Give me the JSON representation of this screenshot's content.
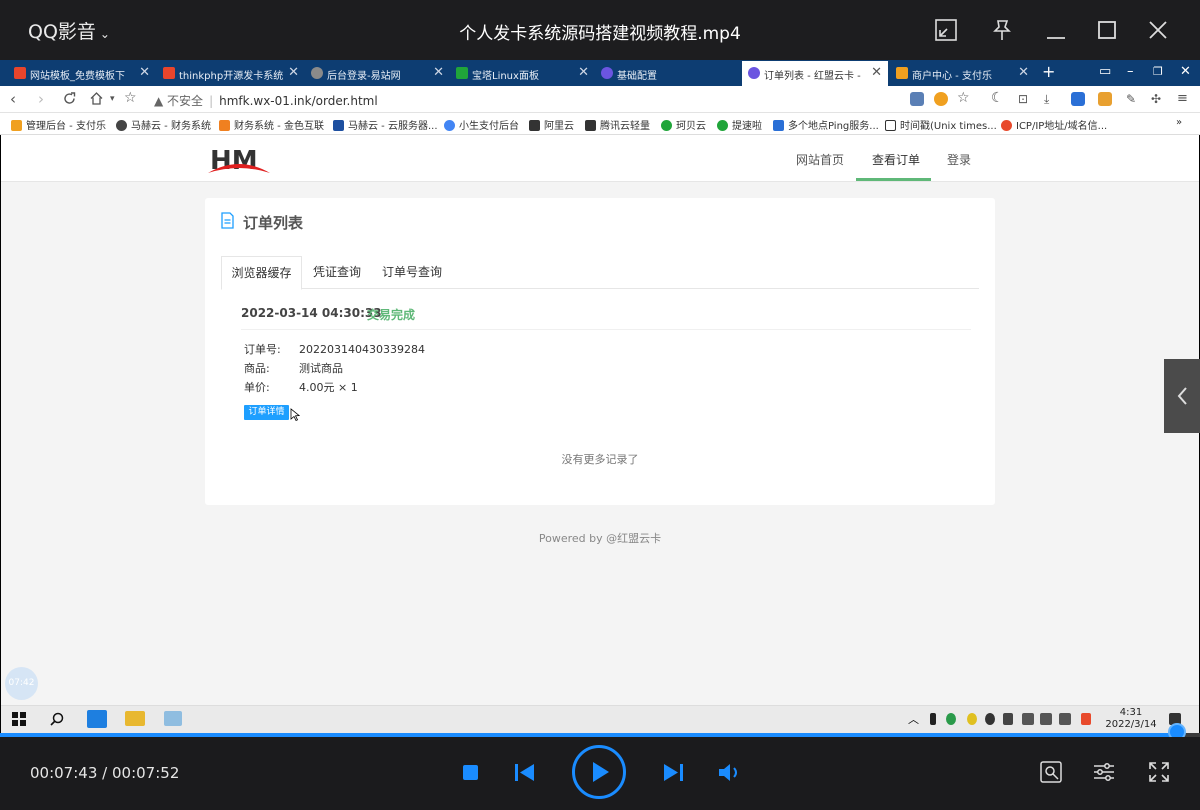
{
  "player": {
    "app_name": "QQ影音",
    "file_title": "个人发卡系统源码搭建视频教程.mp4",
    "time_current": "00:07:43",
    "time_separator": "/",
    "time_total": "00:07:52",
    "progress": 0.981,
    "accent_color": "#1a8cff",
    "watermark": "07:42"
  },
  "browser": {
    "tabs": [
      {
        "label": "网站模板_免费模板下",
        "icon_color": "#e8452c"
      },
      {
        "label": "thinkphp开源发卡系统",
        "icon_color": "#e8452c"
      },
      {
        "label": "后台登录-易站网",
        "icon_color": "#8a8a8a"
      },
      {
        "label": "宝塔Linux面板",
        "icon_color": "#20a53a"
      },
      {
        "label": "基础配置",
        "icon_color": "#6b55e0"
      },
      {
        "label": "订单列表 - 红盟云卡 -",
        "icon_color": "#6b55e0"
      },
      {
        "label": "商户中心 - 支付乐",
        "icon_color": "#f0a020"
      }
    ],
    "url_warning": "不安全",
    "url": "hmfk.wx-01.ink/order.html",
    "bookmarks": [
      "管理后台 - 支付乐",
      "马赫云 - 财务系统",
      "财务系统 - 金色互联",
      "马赫云 - 云服务器...",
      "小生支付后台",
      "阿里云",
      "腾讯云轻量",
      "珂贝云",
      "提速啦",
      "多个地点Ping服务...",
      "时间戳(Unix times...",
      "ICP/IP地址/域名信..."
    ],
    "bookmarks_more": "»"
  },
  "site": {
    "logo_text": "HM",
    "nav": [
      "网站首页",
      "查看订单",
      "登录"
    ],
    "card_title": "订单列表",
    "tabs": [
      "浏览器缓存",
      "凭证查询",
      "订单号查询"
    ],
    "order": {
      "date": "2022-03-14 04:30:33",
      "status": "交易完成",
      "rows": [
        {
          "key": "订单号:",
          "value": "202203140430339284"
        },
        {
          "key": "商品:",
          "value": "测试商品"
        },
        {
          "key": "单价:",
          "value": "4.00元 × 1"
        }
      ],
      "detail_button": "订单详情"
    },
    "no_more": "没有更多记录了",
    "powered": "Powered by @红盟云卡",
    "status_color": "#5fb878",
    "button_color": "#1e9fff"
  },
  "taskbar": {
    "time": "4:31",
    "date": "2022/3/14"
  }
}
